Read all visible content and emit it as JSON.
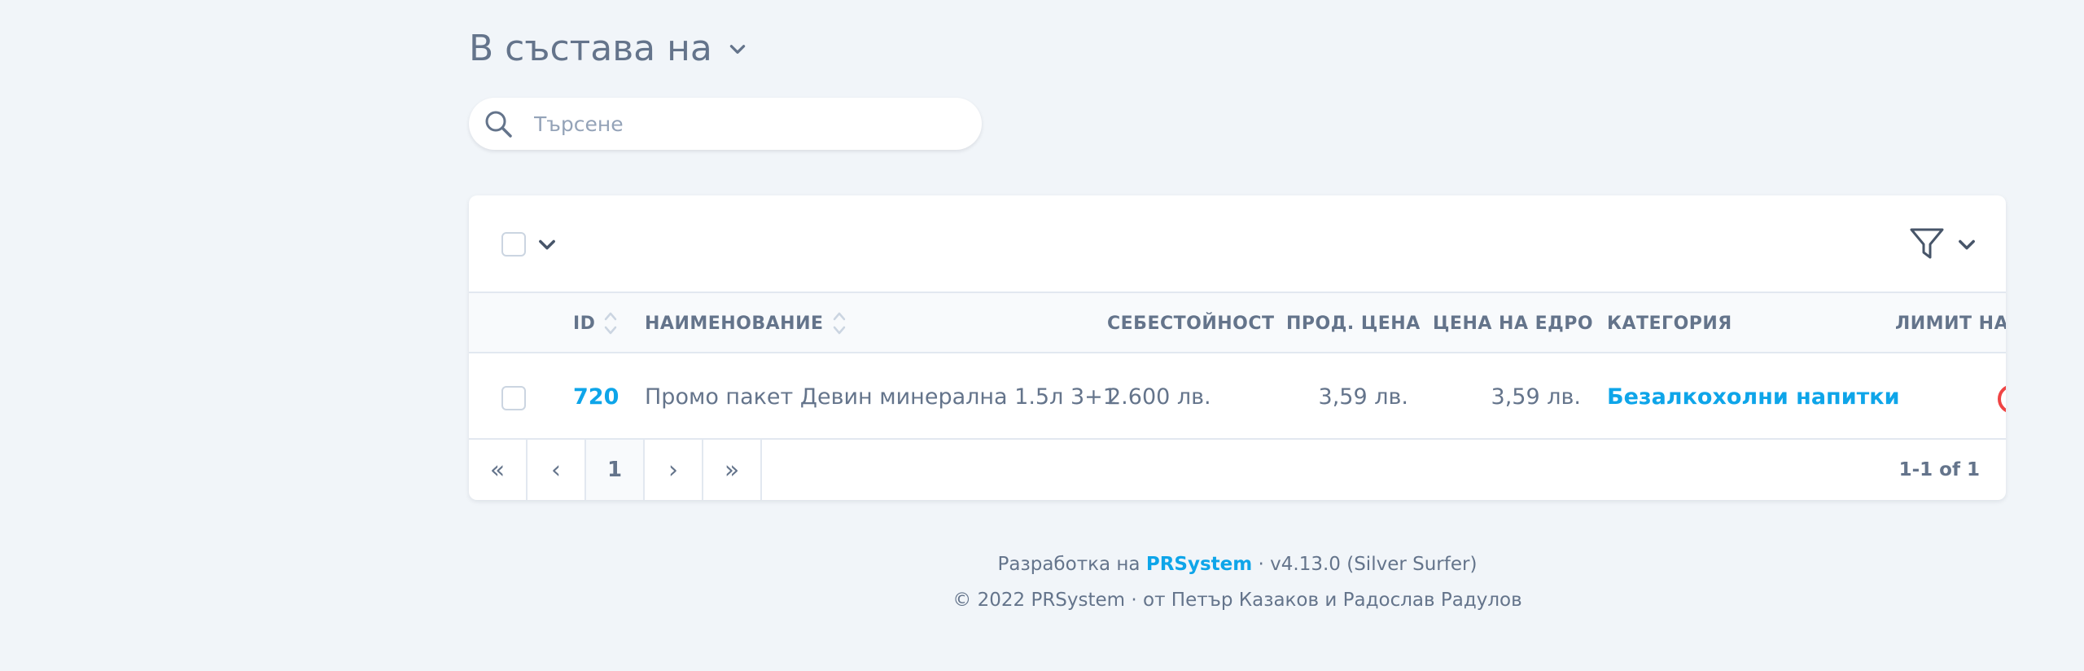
{
  "section": {
    "title": "В състава на",
    "icon": "chevron-down-icon"
  },
  "search": {
    "placeholder": "Търсене",
    "value": "",
    "icon": "search-icon"
  },
  "toolbar": {
    "select_all_icon": "checkbox",
    "bulk_menu_icon": "chevron-down-icon",
    "filter_icon": "filter-icon"
  },
  "table": {
    "columns": [
      {
        "label": "ID",
        "sortable": true
      },
      {
        "label": "НАИМЕНОВАНИЕ",
        "sortable": true
      },
      {
        "label": "СЕБЕСТОЙНОСТ",
        "sortable": false
      },
      {
        "label": "ПРОД. ЦЕНА",
        "sortable": false
      },
      {
        "label": "ЦЕНА НА ЕДРО",
        "sortable": false
      },
      {
        "label": "КАТЕГОРИЯ",
        "sortable": false
      },
      {
        "label": "ЛИМИТ НА",
        "sortable": false
      }
    ],
    "rows": [
      {
        "id": "720",
        "name": "Промо пакет Девин минерална 1.5л 3+1",
        "cost": "2.600 лв.",
        "sale_price": "3,59 лв.",
        "wholesale_price": "3,59 лв.",
        "category": "Безалкохолни напитки"
      }
    ]
  },
  "pagination": {
    "first": "«",
    "prev": "‹",
    "current": "1",
    "next": "›",
    "last": "»",
    "count": "1-1 of 1"
  },
  "footer": {
    "dev_prefix": "Разработка на",
    "brand": "PRSystem",
    "version": "· v4.13.0 (Silver Surfer)",
    "copyright": "© 2022 PRSystem · от Петър Казаков и Радослав Радулов"
  },
  "colors": {
    "background": "#f1f5f9",
    "accent": "#0ea5e9",
    "text": "#64748b",
    "danger": "#ef4444"
  }
}
